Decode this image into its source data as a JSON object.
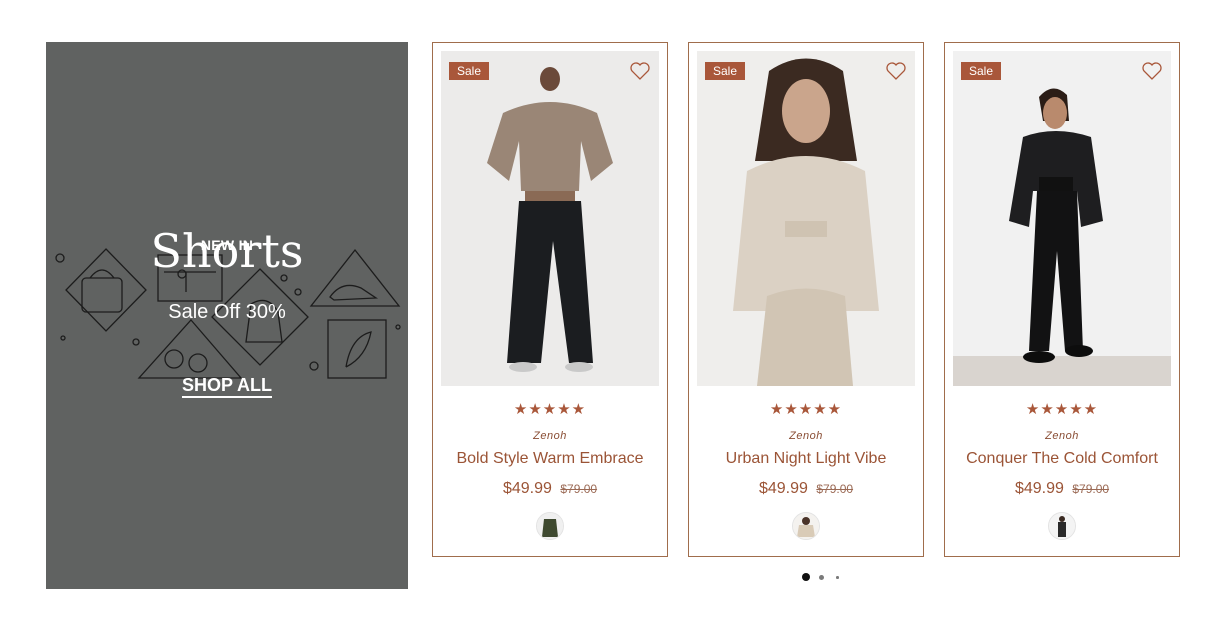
{
  "promo": {
    "eyebrow": "NEW IN",
    "title": "Shorts",
    "subtitle": "Sale Off 30%",
    "cta": "SHOP ALL",
    "background": "#606261"
  },
  "colors": {
    "accent": "#a9573a",
    "card_border": "#a06d4c"
  },
  "products": [
    {
      "badge": "Sale",
      "rating": 5,
      "stars": "★★★★★",
      "vendor": "Zenoh",
      "name": "Bold Style Warm Embrace",
      "price": "$49.99",
      "compare_price": "$79.00",
      "swatch_color": "#3f4a30",
      "wishlist_icon": "heart-outline-icon"
    },
    {
      "badge": "Sale",
      "rating": 5,
      "stars": "★★★★★",
      "vendor": "Zenoh",
      "name": "Urban Night Light Vibe",
      "price": "$49.99",
      "compare_price": "$79.00",
      "swatch_color": "#d9cbb7",
      "wishlist_icon": "heart-outline-icon"
    },
    {
      "badge": "Sale",
      "rating": 5,
      "stars": "★★★★★",
      "vendor": "Zenoh",
      "name": "Conquer The Cold Comfort",
      "price": "$49.99",
      "compare_price": "$79.00",
      "swatch_color": "#2a2a2a",
      "wishlist_icon": "heart-outline-icon"
    }
  ],
  "carousel": {
    "page_count": 3,
    "active_index": 0
  }
}
